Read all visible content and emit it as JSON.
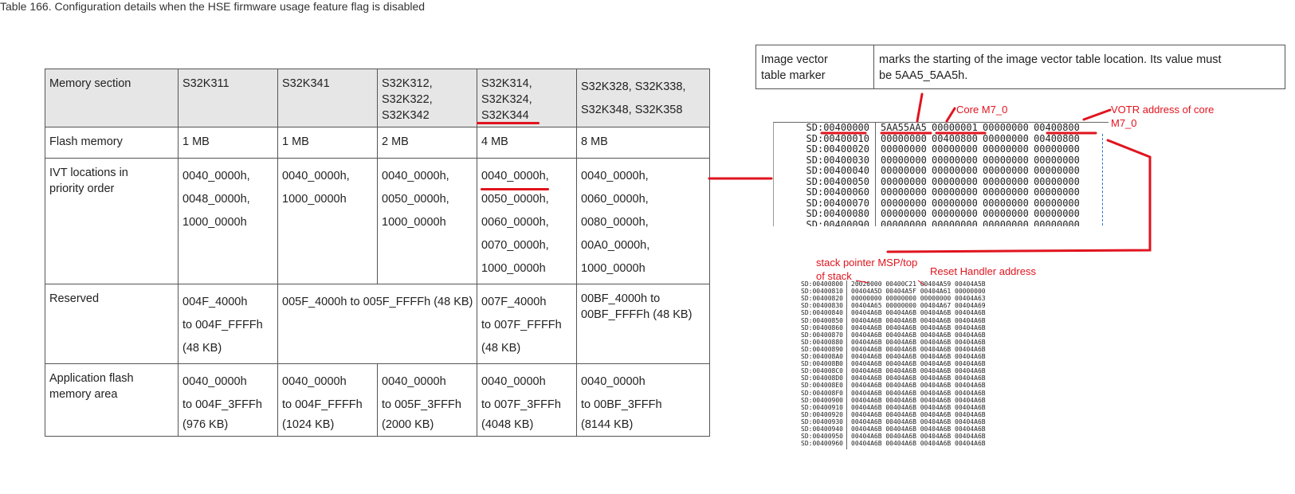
{
  "table": {
    "caption": "Table 166.  Configuration details when the HSE firmware usage feature flag is disabled",
    "headers": [
      [
        "Memory section"
      ],
      [
        "S32K311"
      ],
      [
        "S32K341"
      ],
      [
        "S32K312,",
        "S32K322,",
        "S32K342"
      ],
      [
        "S32K314,",
        "S32K324,",
        "S32K344"
      ],
      [
        "S32K328, S32K338,",
        "S32K348, S32K358"
      ]
    ],
    "flash": {
      "label": "Flash memory",
      "values": [
        "1 MB",
        "1 MB",
        "2 MB",
        "4 MB",
        "8 MB"
      ]
    },
    "ivt": {
      "label": [
        "IVT locations in",
        "priority order"
      ],
      "cols": [
        [
          "0040_0000h,",
          "0048_0000h,",
          "1000_0000h"
        ],
        [
          "0040_0000h,",
          "1000_0000h"
        ],
        [
          "0040_0000h,",
          "0050_0000h,",
          "1000_0000h"
        ],
        [
          "0040_0000h,",
          "0050_0000h,",
          "0060_0000h,",
          "0070_0000h,",
          "1000_0000h"
        ],
        [
          "0040_0000h,",
          "0060_0000h,",
          "0080_0000h,",
          "00A0_0000h,",
          "1000_0000h"
        ]
      ]
    },
    "reserved": {
      "label": "Reserved",
      "c1": [
        "004F_4000h",
        "to 004F_FFFFh",
        "(48 KB)"
      ],
      "c23": "005F_4000h to 005F_FFFFh (48 KB)",
      "c4": [
        "007F_4000h",
        "to 007F_FFFFh",
        "(48 KB)"
      ],
      "c5": [
        "00BF_4000h to",
        "00BF_FFFFh (48 KB)"
      ]
    },
    "app": {
      "label": [
        "Application flash",
        "memory area"
      ],
      "cols": [
        [
          "0040_0000h",
          "to 004F_3FFFh",
          "(976 KB)"
        ],
        [
          "0040_0000h",
          "to 004F_FFFFh",
          "(1024 KB)"
        ],
        [
          "0040_0000h",
          "to 005F_3FFFh",
          "(2000 KB)"
        ],
        [
          "0040_0000h",
          "to 007F_3FFFh",
          "(4048 KB)"
        ],
        [
          "0040_0000h",
          "to 00BF_3FFFh",
          "(8144 KB)"
        ]
      ]
    }
  },
  "marker": {
    "label": [
      "Image vector",
      "table marker"
    ],
    "desc": [
      "marks the starting of the image vector table location. Its value must",
      "be 5AA5_5AA5h."
    ]
  },
  "dump1": {
    "rows": [
      {
        "addr": "SD:00400000",
        "vals": "5AA55AA5 00000001 00000000 00400800"
      },
      {
        "addr": "SD:00400010",
        "vals": "00000000 00400800 00000000 00400800"
      },
      {
        "addr": "SD:00400020",
        "vals": "00000000 00000000 00000000 00000000"
      },
      {
        "addr": "SD:00400030",
        "vals": "00000000 00000000 00000000 00000000"
      },
      {
        "addr": "SD:00400040",
        "vals": "00000000 00000000 00000000 00000000"
      },
      {
        "addr": "SD:00400050",
        "vals": "00000000 00000000 00000000 00000000"
      },
      {
        "addr": "SD:00400060",
        "vals": "00000000 00000000 00000000 00000000"
      },
      {
        "addr": "SD:00400070",
        "vals": "00000000 00000000 00000000 00000000"
      },
      {
        "addr": "SD:00400080",
        "vals": "00000000 00000000 00000000 00000000"
      },
      {
        "addr": "SD:00400090",
        "vals": "00000000 00000000 00000000 00000000"
      }
    ]
  },
  "dump2": {
    "rows": [
      {
        "addr": "SD:00400800",
        "vals": "20020000 00400C21 00404A59 00404A5B"
      },
      {
        "addr": "SD:00400810",
        "vals": "00404A5D 00404A5F 00404A61 00000000"
      },
      {
        "addr": "SD:00400820",
        "vals": "00000000 00000000 00000000 00404A63"
      },
      {
        "addr": "SD:00400830",
        "vals": "00404A65 00000000 00404A67 00404A69"
      },
      {
        "addr": "SD:00400840",
        "vals": "00404A6B 00404A6B 00404A6B 00404A6B"
      },
      {
        "addr": "SD:00400850",
        "vals": "00404A6B 00404A6B 00404A6B 00404A6B"
      },
      {
        "addr": "SD:00400860",
        "vals": "00404A6B 00404A6B 00404A6B 00404A6B"
      },
      {
        "addr": "SD:00400870",
        "vals": "00404A6B 00404A6B 00404A6B 00404A6B"
      },
      {
        "addr": "SD:00400880",
        "vals": "00404A6B 00404A6B 00404A6B 00404A6B"
      },
      {
        "addr": "SD:00400890",
        "vals": "00404A6B 00404A6B 00404A6B 00404A6B"
      },
      {
        "addr": "SD:004008A0",
        "vals": "00404A6B 00404A6B 00404A6B 00404A6B"
      },
      {
        "addr": "SD:004008B0",
        "vals": "00404A6B 00404A6B 00404A6B 00404A6B"
      },
      {
        "addr": "SD:004008C0",
        "vals": "00404A6B 00404A6B 00404A6B 00404A6B"
      },
      {
        "addr": "SD:004008D0",
        "vals": "00404A6B 00404A6B 00404A6B 00404A6B"
      },
      {
        "addr": "SD:004008E0",
        "vals": "00404A6B 00404A6B 00404A6B 00404A6B"
      },
      {
        "addr": "SD:004008F0",
        "vals": "00404A6B 00404A6B 00404A6B 00404A6B"
      },
      {
        "addr": "SD:00400900",
        "vals": "00404A6B 00404A6B 00404A6B 00404A6B"
      },
      {
        "addr": "SD:00400910",
        "vals": "00404A6B 00404A6B 00404A6B 00404A6B"
      },
      {
        "addr": "SD:00400920",
        "vals": "00404A6B 00404A6B 00404A6B 00404A6B"
      },
      {
        "addr": "SD:00400930",
        "vals": "00404A6B 00404A6B 00404A6B 00404A6B"
      },
      {
        "addr": "SD:00400940",
        "vals": "00404A6B 00404A6B 00404A6B 00404A6B"
      },
      {
        "addr": "SD:00400950",
        "vals": "00404A6B 00404A6B 00404A6B 00404A6B"
      },
      {
        "addr": "SD:00400960",
        "vals": "00404A6B 00404A6B 00404A6B 00404A6B"
      }
    ]
  },
  "annotations": {
    "core": "Core M7_0",
    "votr": [
      "VOTR address of core",
      "M7_0"
    ],
    "stack": [
      "stack pointer MSP/top",
      "of stack"
    ],
    "reset": "Reset Handler address",
    "color": "#e0141e"
  }
}
